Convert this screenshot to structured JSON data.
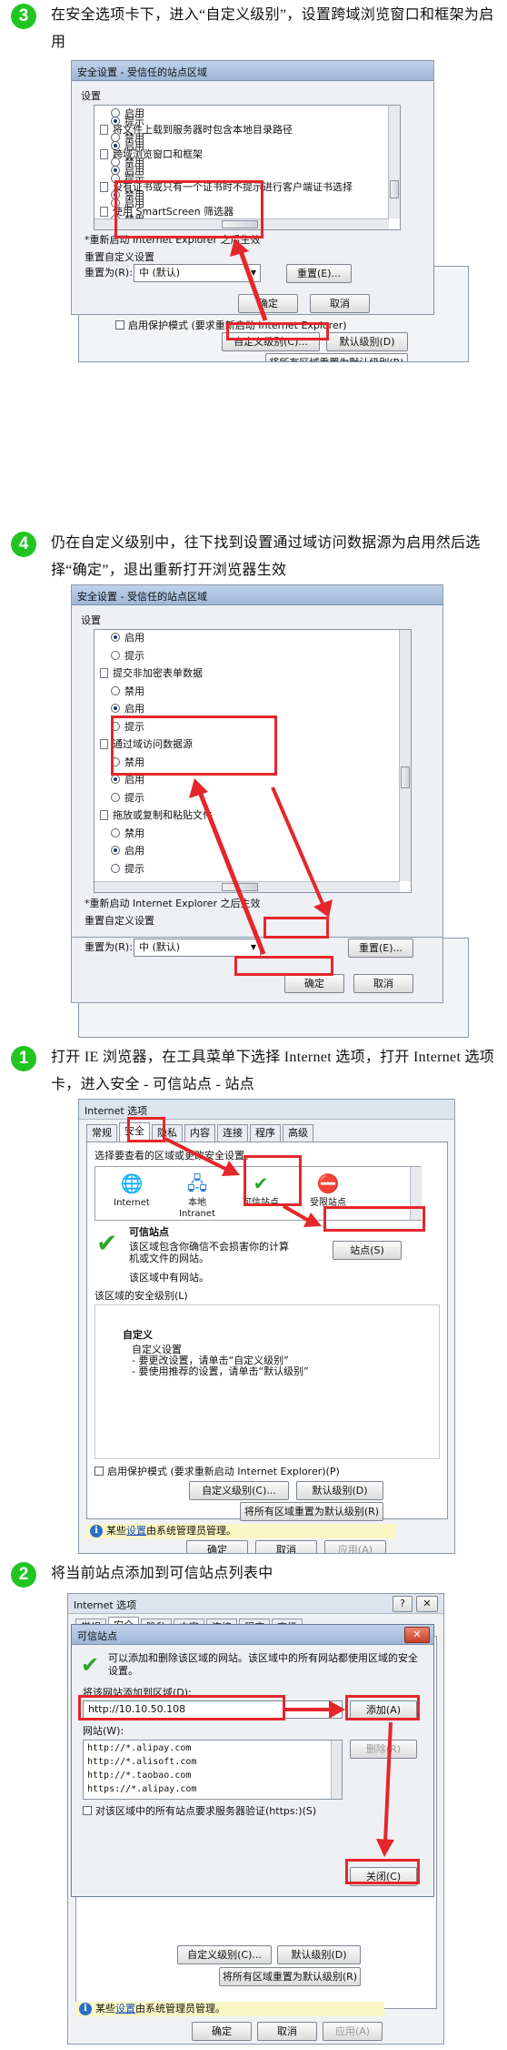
{
  "steps": [
    {
      "num": "3",
      "text": "在安全选项卡下，进入“自定义级别”，设置跨域浏览窗口和框架为启用"
    },
    {
      "num": "4",
      "text": "仍在自定义级别中，往下找到设置通过域访问数据源为启用然后选择“确定”，退出重新打开浏览器生效"
    },
    {
      "num": "1",
      "text": "打开 IE 浏览器，在工具菜单下选择 Internet 选项，打开 Internet 选项卡，进入安全 - 可信站点 - 站点"
    },
    {
      "num": "2",
      "text": "将当前站点添加到可信站点列表中"
    }
  ],
  "security_dialog": {
    "title": "安全设置 - 受信任的站点区域",
    "settings_label": "设置",
    "note": "*重新启动 Internet Explorer 之后生效",
    "reset_group": "重置自定义设置",
    "reset_to_label": "重置为(R):",
    "reset_value": "中 (默认)",
    "reset_button": "重置(E)...",
    "ok": "确定",
    "cancel": "取消",
    "list1": [
      {
        "t": "radio",
        "label": "启用",
        "on": false
      },
      {
        "t": "radio",
        "label": "提示",
        "on": true
      },
      {
        "t": "head",
        "label": "将文件上载到服务器时包含本地目录路径"
      },
      {
        "t": "radio",
        "label": "禁用",
        "on": false
      },
      {
        "t": "radio",
        "label": "启用",
        "on": true
      },
      {
        "t": "head",
        "label": "跨域浏览窗口和框架"
      },
      {
        "t": "radio",
        "label": "禁用",
        "on": false
      },
      {
        "t": "radio",
        "label": "启用",
        "on": true
      },
      {
        "t": "radio",
        "label": "提示",
        "on": false
      },
      {
        "t": "head",
        "label": "没有证书或只有一个证书时不提示进行客户端证书选择"
      },
      {
        "t": "radio",
        "label": "禁用",
        "on": true
      },
      {
        "t": "radio",
        "label": "启用",
        "on": false
      },
      {
        "t": "head",
        "label": "使用 SmartScreen 筛选器"
      },
      {
        "t": "radio",
        "label": "禁用",
        "on": false
      },
      {
        "t": "radio",
        "label": "启用",
        "on": false
      }
    ],
    "list2": [
      {
        "t": "radio",
        "label": "启用",
        "on": true
      },
      {
        "t": "radio",
        "label": "提示",
        "on": false
      },
      {
        "t": "head",
        "label": "提交非加密表单数据"
      },
      {
        "t": "radio",
        "label": "禁用",
        "on": false
      },
      {
        "t": "radio",
        "label": "启用",
        "on": true
      },
      {
        "t": "radio",
        "label": "提示",
        "on": false
      },
      {
        "t": "head",
        "label": "通过域访问数据源"
      },
      {
        "t": "radio",
        "label": "禁用",
        "on": false
      },
      {
        "t": "radio",
        "label": "启用",
        "on": true
      },
      {
        "t": "radio",
        "label": "提示",
        "on": false
      },
      {
        "t": "head",
        "label": "拖放或复制和粘贴文件"
      },
      {
        "t": "radio",
        "label": "禁用",
        "on": false
      },
      {
        "t": "radio",
        "label": "启用",
        "on": true
      },
      {
        "t": "radio",
        "label": "提示",
        "on": false
      }
    ]
  },
  "bg_panel": {
    "protect_mode": "启用保护模式 (要求重新启动 Internet Explorer)",
    "custom_level": "自定义级别(C)...",
    "default_level": "默认级别(D)",
    "reset_all": "将所有区域重置为默认级别(R)"
  },
  "internet_options": {
    "title": "Internet 选项",
    "tabs": [
      "常规",
      "安全",
      "隐私",
      "内容",
      "连接",
      "程序",
      "高级"
    ],
    "zone_prompt": "选择要查看的区域或更改安全设置。",
    "zones": [
      "Internet",
      "本地 Intranet",
      "可信站点",
      "受限站点"
    ],
    "zone_name": "可信站点",
    "zone_desc": "该区域包含你确信不会损害你的计算机或文件的网站。",
    "zone_has_sites": "该区域中有网站。",
    "sites_button": "站点(S)",
    "level_group": "该区域的安全级别(L)",
    "custom_title": "自定义",
    "custom_lines": [
      "自定义设置",
      "- 要更改设置，请单击“自定义级别”",
      "- 要使用推荐的设置，请单击“默认级别”"
    ],
    "protect_mode": "启用保护模式 (要求重新启动 Internet Explorer)(P)",
    "custom_level": "自定义级别(C)...",
    "default_level": "默认级别(D)",
    "reset_all": "将所有区域重置为默认级别(R)",
    "admin_note_pre": "某些",
    "admin_note_link": "设置",
    "admin_note_post": "由系统管理员管理。",
    "ok": "确定",
    "cancel": "取消",
    "apply": "应用(A)"
  },
  "trusted_sites": {
    "outer_title": "Internet 选项",
    "title": "可信站点",
    "help": "?",
    "close": "✕",
    "desc": "可以添加和删除该区域的网站。该区域中的所有网站都使用区域的安全设置。",
    "add_label": "将该网站添加到区域(D):",
    "url": "http://10.10.50.108",
    "add_button": "添加(A)",
    "sites_label": "网站(W):",
    "sites": [
      "http://*.alipay.com",
      "http://*.alisoft.com",
      "http://*.taobao.com",
      "https://*.alipay.com"
    ],
    "remove_button": "删除(R)",
    "https_label": "对该区域中的所有站点要求服务器验证(https:)(S)",
    "close_button": "关闭(C)"
  },
  "colors": {
    "accent": "#e5262a",
    "badge": "#21c521"
  }
}
